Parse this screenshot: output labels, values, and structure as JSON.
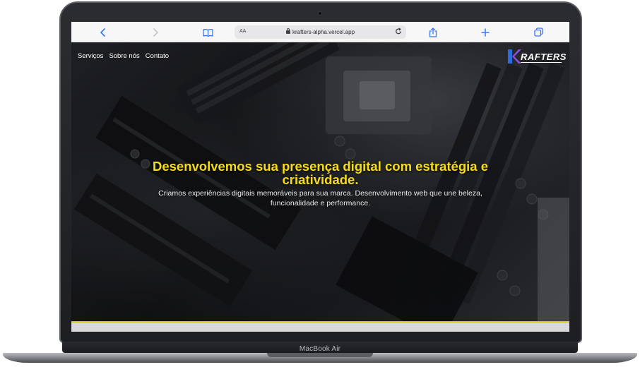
{
  "device": {
    "model_label": "MacBook Air"
  },
  "browser": {
    "address_text_size": "AA",
    "url": "krafters-alpha.vercel.app",
    "icons": {
      "back": "chevron-left-icon",
      "forward": "chevron-right-icon",
      "bookmarks": "book-icon",
      "lock": "lock-icon",
      "reload": "reload-icon",
      "share": "share-icon",
      "new_tab": "plus-icon",
      "tabs": "tabs-icon"
    },
    "accent_color": "#3478f6"
  },
  "site": {
    "nav": [
      "Serviços",
      "Sobre nós",
      "Contato"
    ],
    "logo_text": "RAFTERS",
    "headline": "Desenvolvemos sua presença digital com estratégia e criatividade.",
    "subheadline": "Criamos experiências digitais memoráveis para sua marca. Desenvolvimento web que une beleza, funcionalidade e performance.",
    "headline_color": "#f5dc1a",
    "background_image": "motherboard-photo"
  }
}
